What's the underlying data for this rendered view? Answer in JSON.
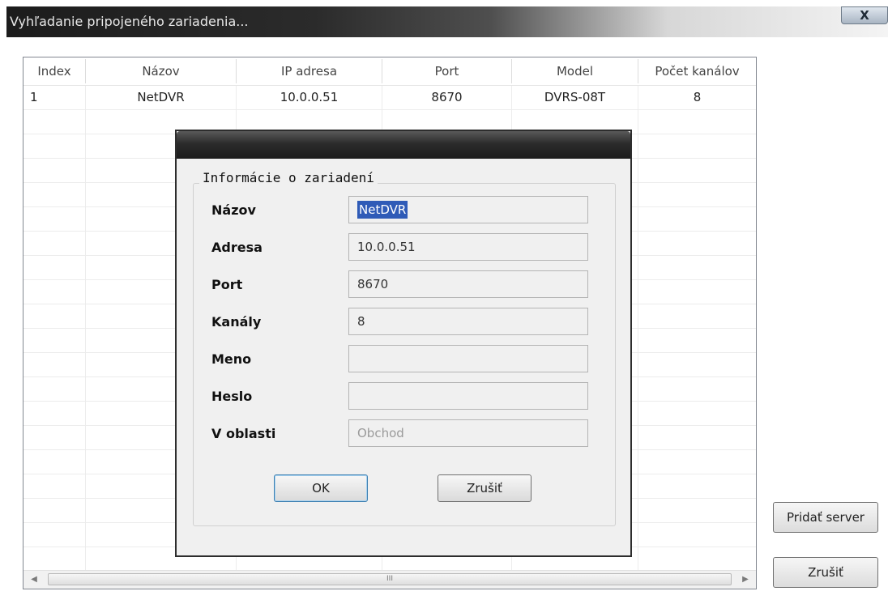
{
  "window": {
    "title": "Vyhľadanie pripojeného zariadenia...",
    "close_label": "X"
  },
  "table": {
    "columns": [
      "Index",
      "Názov",
      "IP adresa",
      "Port",
      "Model",
      "Počet kanálov"
    ],
    "rows": [
      [
        "1",
        "NetDVR",
        "10.0.0.51",
        "8670",
        "DVRS-08T",
        "8"
      ]
    ],
    "scroll_grip": "III"
  },
  "side_buttons": {
    "add_server": "Pridať server",
    "cancel": "Zrušiť"
  },
  "dialog": {
    "group_title": "Informácie o zariadení",
    "fields": [
      {
        "label": "Názov",
        "value": "NetDVR"
      },
      {
        "label": "Adresa",
        "value": "10.0.0.51"
      },
      {
        "label": "Port",
        "value": "8670"
      },
      {
        "label": "Kanály",
        "value": "8"
      },
      {
        "label": "Meno",
        "value": ""
      },
      {
        "label": "Heslo",
        "value": ""
      },
      {
        "label": "V oblasti",
        "value": "Obchod"
      }
    ],
    "ok_label": "OK",
    "cancel_label": "Zrušiť"
  }
}
